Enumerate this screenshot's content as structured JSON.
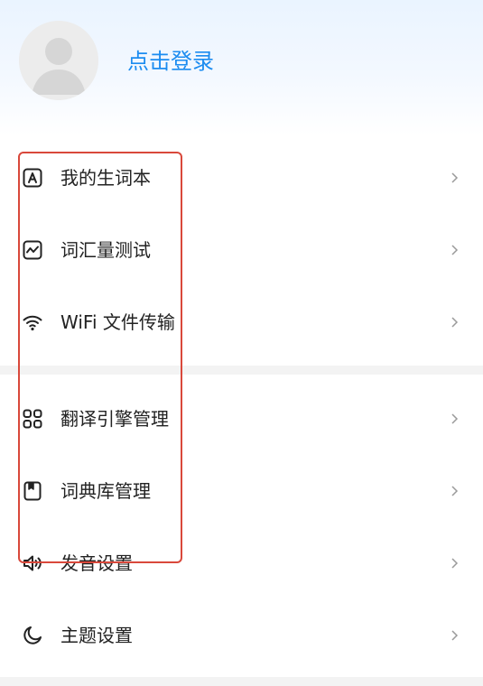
{
  "profile": {
    "login_label": "点击登录"
  },
  "menu": {
    "group1": [
      {
        "label": "我的生词本",
        "icon": "letter-a-box-icon"
      },
      {
        "label": "词汇量测试",
        "icon": "trend-chart-icon"
      },
      {
        "label": "WiFi 文件传输",
        "icon": "wifi-icon"
      }
    ],
    "group2": [
      {
        "label": "翻译引擎管理",
        "icon": "grid-apps-icon"
      },
      {
        "label": "词典库管理",
        "icon": "book-icon"
      },
      {
        "label": "发音设置",
        "icon": "speaker-icon"
      },
      {
        "label": "主题设置",
        "icon": "moon-icon"
      }
    ]
  },
  "colors": {
    "accent": "#1c8cf0",
    "highlight_border": "#d9483b",
    "separator": "#f3f3f3"
  }
}
